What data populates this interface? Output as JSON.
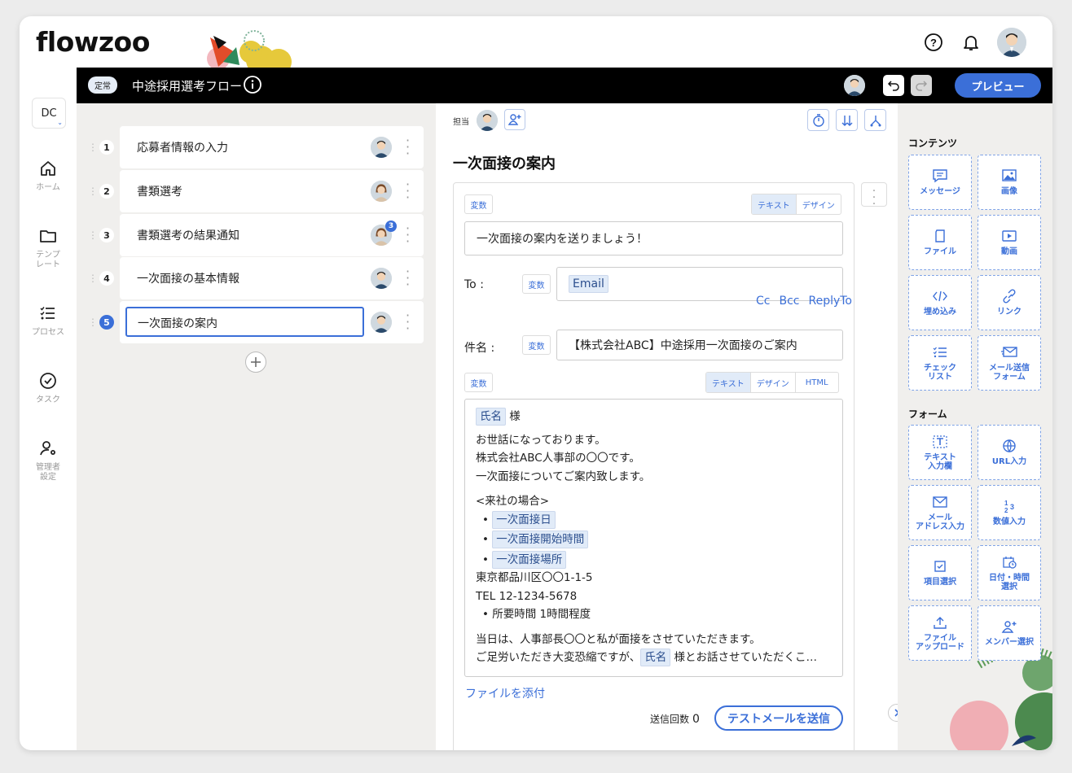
{
  "app": {
    "logo": "flowzoo"
  },
  "flow": {
    "badge": "定常",
    "title": "中途採用選考フロー",
    "preview_label": "プレビュー"
  },
  "leftnav": {
    "dc_label": "DC",
    "items": [
      {
        "label": "ホーム",
        "icon": "home-icon"
      },
      {
        "label": "テンプ\nレート",
        "icon": "folder-icon"
      },
      {
        "label": "プロセス",
        "icon": "process-list-icon"
      },
      {
        "label": "タスク",
        "icon": "check-circle-icon"
      },
      {
        "label": "管理者\n設定",
        "icon": "admin-settings-icon"
      }
    ]
  },
  "steps": [
    {
      "num": "1",
      "label": "応募者情報の入力",
      "notif": ""
    },
    {
      "num": "2",
      "label": "書類選考",
      "notif": ""
    },
    {
      "num": "3",
      "label": "書類選考の結果通知",
      "notif": "3"
    },
    {
      "num": "4",
      "label": "一次面接の基本情報",
      "notif": ""
    },
    {
      "num": "5",
      "label": "一次面接の案内",
      "notif": ""
    }
  ],
  "editor": {
    "assignee_label": "担当",
    "title": "一次面接の案内",
    "var_label": "変数",
    "mode_tabs": [
      "テキスト",
      "デザイン"
    ],
    "body_tabs": [
      "テキスト",
      "デザイン",
      "HTML"
    ],
    "intro_text": "一次面接の案内を送りましょう！",
    "to_label": "To :",
    "to_token": "Email",
    "cc": [
      "Cc",
      "Bcc",
      "ReplyTo"
    ],
    "subject_label": "件名 :",
    "subject_value": "【株式会社ABC】中途採用一次面接のご案内",
    "body": {
      "name_token": "氏名",
      "sama": "様",
      "line1": "お世話になっております。",
      "line2": "株式会社ABC人事部の〇〇です。",
      "line3": "一次面接についてご案内致します。",
      "line4": "<来社の場合>",
      "bullet_tokens": [
        "一次面接日",
        "一次面接開始時間",
        "一次面接場所"
      ],
      "address": "東京都品川区〇〇1-1-5",
      "tel": "TEL 12-1234-5678",
      "duration": "所要時間 1時間程度",
      "line5": "当日は、人事部長〇〇と私が面接をさせていただきます。",
      "line6a": "ご足労いただき大変恐縮ですが、",
      "line6b": "様とお話させていただくこ…"
    },
    "attach_label": "ファイルを添付",
    "send_count_label": "送信回数",
    "send_count": "0",
    "test_send_label": "テストメールを送信"
  },
  "palette": {
    "contents_header": "コンテンツ",
    "contents": [
      {
        "label": "メッセージ",
        "icon": "message-icon"
      },
      {
        "label": "画像",
        "icon": "image-icon"
      },
      {
        "label": "ファイル",
        "icon": "file-icon"
      },
      {
        "label": "動画",
        "icon": "video-icon"
      },
      {
        "label": "埋め込み",
        "icon": "code-icon"
      },
      {
        "label": "リンク",
        "icon": "link-icon"
      },
      {
        "label": "チェック\nリスト",
        "icon": "checklist-icon"
      },
      {
        "label": "メール送信\nフォーム",
        "icon": "mail-send-icon"
      }
    ],
    "form_header": "フォーム",
    "forms": [
      {
        "label": "テキスト\n入力欄",
        "icon": "text-field-icon"
      },
      {
        "label": "URL入力",
        "icon": "globe-icon"
      },
      {
        "label": "メール\nアドレス入力",
        "icon": "mail-icon"
      },
      {
        "label": "数値入力",
        "icon": "number-icon"
      },
      {
        "label": "項目選択",
        "icon": "checkbox-icon"
      },
      {
        "label": "日付・時間\n選択",
        "icon": "calendar-clock-icon"
      },
      {
        "label": "ファイル\nアップロード",
        "icon": "upload-icon"
      },
      {
        "label": "メンバー選択",
        "icon": "member-add-icon"
      }
    ]
  },
  "colors": {
    "accent": "#3b6fd8",
    "panel_bg": "#f0efed",
    "token_bg": "#e1ebf8"
  }
}
